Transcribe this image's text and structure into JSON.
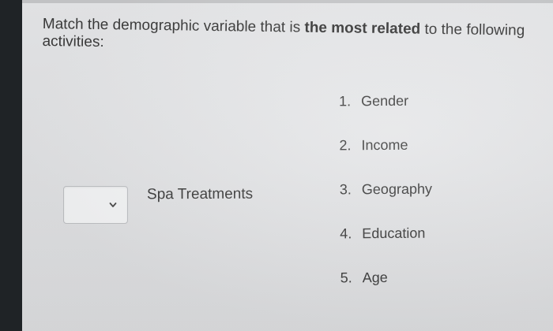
{
  "question": {
    "prefix": "Match the demographic variable that is ",
    "emphasis": "the most related",
    "suffix": " to the following activities:"
  },
  "activity": {
    "label": "Spa Treatments",
    "dropdown_value": "",
    "dropdown_icon": "chevron-down-icon"
  },
  "answers": [
    {
      "num": "1.",
      "label": "Gender"
    },
    {
      "num": "2.",
      "label": "Income"
    },
    {
      "num": "3.",
      "label": "Geography"
    },
    {
      "num": "4.",
      "label": "Education"
    },
    {
      "num": "5.",
      "label": "Age"
    }
  ],
  "colors": {
    "background": "#e6e7e9",
    "text": "#3a3a3a",
    "border": "#bfc1c4"
  }
}
